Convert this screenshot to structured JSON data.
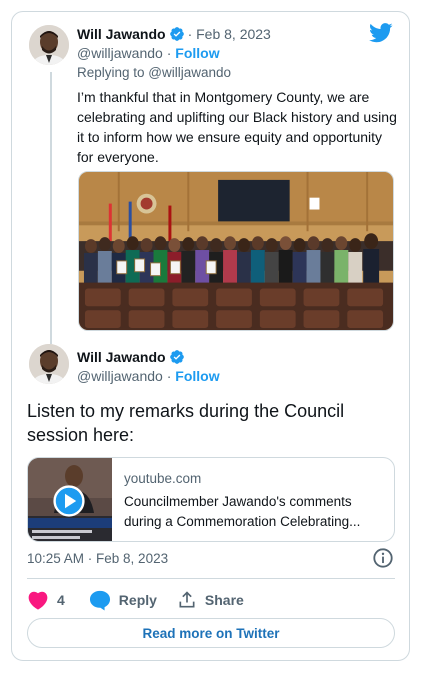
{
  "colors": {
    "accent": "#1d9bf0",
    "heart": "#f91880",
    "muted": "#536471",
    "border": "#cfd9de"
  },
  "icons": {
    "brand": "twitter-bird-icon",
    "verified": "verified-badge-icon",
    "like": "heart-icon",
    "reply": "speech-bubble-icon",
    "share": "share-upload-icon",
    "info": "info-icon",
    "play": "play-icon"
  },
  "tweet1": {
    "name": "Will Jawando",
    "date": "· Feb 8, 2023",
    "handle": "@willjawando",
    "separator": "·",
    "follow": "Follow",
    "replying_prefix": "Replying to ",
    "replying_handle": "@willjawando",
    "text": "I’m thankful that in Montgomery County, we are celebrating and uplifting our Black history and using it to inform how we ensure equity and opportunity for everyone."
  },
  "tweet2": {
    "name": "Will Jawando",
    "handle": "@willjawando",
    "separator": "·",
    "follow": "Follow",
    "text": "Listen to my remarks during the Council session here:",
    "link": {
      "domain": "youtube.com",
      "title_line1": "Councilmember Jawando's comments",
      "title_line2": "during a Commemoration Celebrating..."
    },
    "timestamp": "10:25 AM · Feb 8, 2023"
  },
  "actions": {
    "likes": "4",
    "reply": "Reply",
    "share": "Share"
  },
  "read_more": "Read more on Twitter"
}
